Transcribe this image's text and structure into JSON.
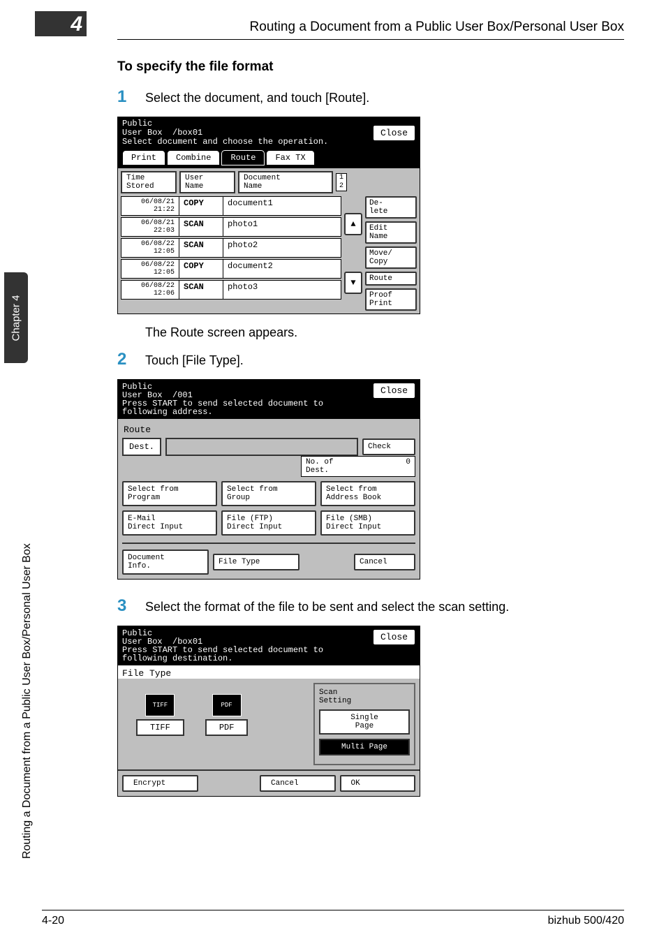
{
  "header": {
    "chapter_num": "4",
    "title": "Routing a Document from a Public User Box/Personal User Box"
  },
  "sidebar": {
    "chapter_tab": "Chapter 4",
    "vertical_title": "Routing a Document from a Public User Box/Personal User Box"
  },
  "section": {
    "title": "To specify the file format",
    "step1_num": "1",
    "step1_text": "Select the document, and touch [Route].",
    "step1_follow": "The Route screen appears.",
    "step2_num": "2",
    "step2_text": "Touch [File Type].",
    "step3_num": "3",
    "step3_text": "Select the format of the file to be sent and select the scan setting."
  },
  "screen1": {
    "breadcrumb_l1": "Public",
    "breadcrumb_l2": "User Box",
    "breadcrumb_box": "/box01",
    "prompt": "Select document and choose the operation.",
    "close": "Close",
    "tab_print": "Print",
    "tab_combine": "Combine",
    "tab_route": "Route",
    "tab_fax": "Fax TX",
    "col_time": "Time\nStored",
    "col_user": "User\nName",
    "col_doc": "Document\nName",
    "page_top": "1",
    "page_bottom": "2",
    "rows": [
      {
        "time": "06/08/21\n21:22",
        "user": "COPY",
        "doc": "document1"
      },
      {
        "time": "06/08/21\n22:03",
        "user": "SCAN",
        "doc": "photo1"
      },
      {
        "time": "06/08/22\n12:05",
        "user": "SCAN",
        "doc": "photo2"
      },
      {
        "time": "06/08/22\n12:05",
        "user": "COPY",
        "doc": "document2"
      },
      {
        "time": "06/08/22\n12:06",
        "user": "SCAN",
        "doc": "photo3"
      }
    ],
    "side": {
      "delete": "De-\nlete",
      "edit": "Edit\nName",
      "move": "Move/\nCopy",
      "route": "Route",
      "proof": "Proof\nPrint"
    }
  },
  "screen2": {
    "breadcrumb_l1": "Public",
    "breadcrumb_l2": "User Box",
    "breadcrumb_id": "/001",
    "prompt": "Press START to send selected document to\nfollowing address.",
    "close": "Close",
    "route_label": "Route",
    "dest_label": "Dest.",
    "check": "Check",
    "ndest_label": "No. of\nDest.",
    "ndest_value": "0",
    "btn_program": "Select from\nProgram",
    "btn_group": "Select from\nGroup",
    "btn_abook": "Select from\nAddress Book",
    "btn_email": "E-Mail\nDirect Input",
    "btn_ftp": "File (FTP)\nDirect Input",
    "btn_smb": "File (SMB)\nDirect Input",
    "btn_docinfo": "Document\nInfo.",
    "btn_filetype": "File Type",
    "btn_cancel": "Cancel"
  },
  "screen3": {
    "breadcrumb_l1": "Public",
    "breadcrumb_l2": "User Box",
    "breadcrumb_box": "/box01",
    "prompt": "Press START to send selected document to\nfollowing destination.",
    "close": "Close",
    "title": "File Type",
    "fmt_tiff_ico": "TIFF",
    "fmt_tiff": "TIFF",
    "fmt_pdf_ico": "PDF",
    "fmt_pdf": "PDF",
    "scan_title": "Scan\nSetting",
    "scan_single": "Single\nPage",
    "scan_multi": "Multi Page",
    "btn_encrypt": "Encrypt",
    "btn_cancel": "Cancel",
    "btn_ok": "OK"
  },
  "footer": {
    "page": "4-20",
    "model": "bizhub 500/420"
  }
}
